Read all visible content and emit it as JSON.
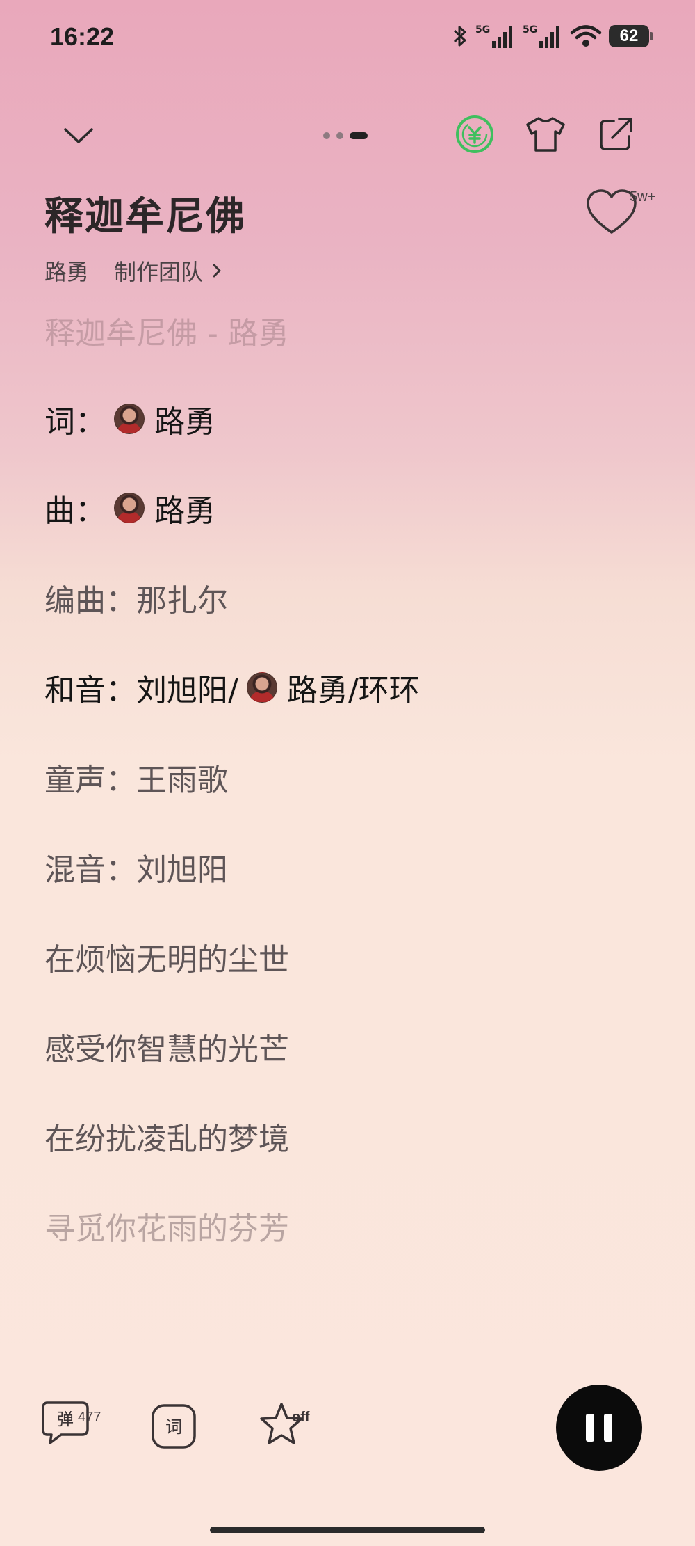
{
  "status_bar": {
    "time": "16:22",
    "network_1": "5G",
    "network_2": "5G",
    "battery": "62",
    "icons": [
      "bluetooth-icon",
      "signal-icon",
      "signal-icon",
      "wifi-icon",
      "battery-icon"
    ]
  },
  "top_bar": {
    "icons": [
      "chevron-down-icon",
      "page-indicator",
      "coin-icon",
      "tshirt-icon",
      "share-icon"
    ],
    "page_indicator": {
      "count": 3,
      "active_index": 2
    },
    "coin_color": "#3fbf5e"
  },
  "song": {
    "title": "释迦牟尼佛",
    "artist": "路勇",
    "team_link": "制作团队",
    "like_count": "5w+"
  },
  "lyrics": {
    "header": "释迦牟尼佛 - 路勇",
    "lyricist_label": "词：",
    "lyricist": "路勇",
    "composer_label": "曲：",
    "composer": "路勇",
    "arranger": "编曲：那扎尔",
    "harmony_label": "和音：",
    "harmony_pre": "刘旭阳/",
    "harmony_post": "路勇/环环",
    "child_voice": "童声：王雨歌",
    "mixing": "混音：刘旭阳",
    "lines": [
      "在烦恼无明的尘世",
      "感受你智慧的光芒",
      "在纷扰凌乱的梦境",
      "寻觅你花雨的芬芳"
    ]
  },
  "bottom_bar": {
    "danmu_label": "弹",
    "danmu_count": "477",
    "lyric_label": "词",
    "star_state": "off",
    "play_state": "playing"
  }
}
